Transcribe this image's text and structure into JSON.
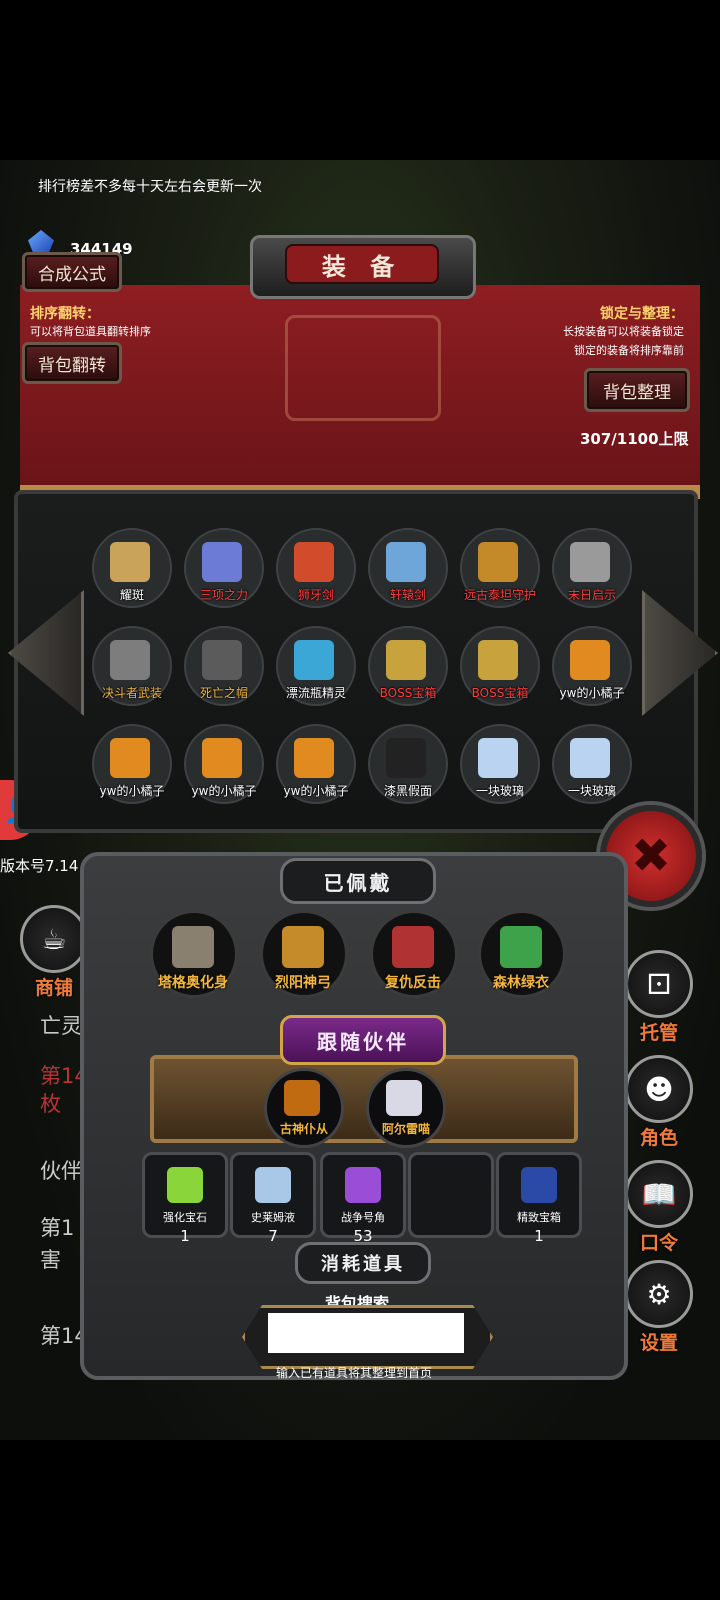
{
  "top_note": "排行榜差不多每十天左右会更新一次",
  "gem_count": "344149",
  "title": "装 备",
  "buttons": {
    "synthesis": "合成公式",
    "flip_bag": "背包翻转",
    "organize_bag": "背包整理"
  },
  "hints": {
    "sort_title": "排序翻转：",
    "sort_text": "可以将背包道具翻转排序",
    "lock_title": "锁定与整理：",
    "lock_text1": "长按装备可以将装备锁定",
    "lock_text2": "锁定的装备将排序靠前"
  },
  "capacity": "307/1100上限",
  "inventory": [
    {
      "label": "耀斑",
      "color": "#ffffff",
      "icon": "sword-icon"
    },
    {
      "label": "三项之力",
      "color": "#ff3b3b",
      "icon": "triple-weapon-icon"
    },
    {
      "label": "狮牙剑",
      "color": "#ff3b3b",
      "icon": "flame-sword-icon"
    },
    {
      "label": "轩辕剑",
      "color": "#ff3b3b",
      "icon": "sword-icon"
    },
    {
      "label": "远古泰坦守护",
      "color": "#ff3b3b",
      "icon": "titan-armor-icon"
    },
    {
      "label": "末日启示",
      "color": "#ff3b3b",
      "icon": "axe-icon"
    },
    {
      "label": "决斗者武装",
      "color": "#f4b63c",
      "icon": "knight-icon"
    },
    {
      "label": "死亡之帽",
      "color": "#f4b63c",
      "icon": "hat-icon"
    },
    {
      "label": "漂流瓶精灵",
      "color": "#ffffff",
      "icon": "spirit-icon"
    },
    {
      "label": "BOSS宝箱",
      "color": "#ff3b3b",
      "icon": "chest-icon"
    },
    {
      "label": "BOSS宝箱",
      "color": "#ff3b3b",
      "icon": "chest-icon"
    },
    {
      "label": "yw的小橘子",
      "color": "#ffffff",
      "icon": "orange-icon"
    },
    {
      "label": "yw的小橘子",
      "color": "#ffffff",
      "icon": "orange-icon"
    },
    {
      "label": "yw的小橘子",
      "color": "#ffffff",
      "icon": "orange-icon"
    },
    {
      "label": "yw的小橘子",
      "color": "#ffffff",
      "icon": "orange-icon"
    },
    {
      "label": "漆黑假面",
      "color": "#ffffff",
      "icon": "mask-icon"
    },
    {
      "label": "一块玻璃",
      "color": "#ffffff",
      "icon": "glass-icon"
    },
    {
      "label": "一块玻璃",
      "color": "#ffffff",
      "icon": "glass-icon"
    }
  ],
  "equipped_title": "已佩戴",
  "equipped": [
    {
      "label": "塔格奥化身",
      "icon": "avatar-icon"
    },
    {
      "label": "烈阳神弓",
      "icon": "bow-icon"
    },
    {
      "label": "复仇反击",
      "icon": "armor-icon"
    },
    {
      "label": "森林绿衣",
      "icon": "green-robe-icon"
    }
  ],
  "companions_title": "跟随伙伴",
  "companions": [
    {
      "label": "古神仆从",
      "icon": "servant-icon"
    },
    {
      "label": "阿尔雷喵",
      "icon": "cat-angel-icon"
    }
  ],
  "consumables": [
    {
      "label": "强化宝石",
      "qty": "1",
      "icon": "gem-icon"
    },
    {
      "label": "史莱姆液",
      "qty": "7",
      "icon": "potion-icon"
    },
    {
      "label": "战争号角",
      "qty": "53",
      "icon": "horn-icon"
    },
    {
      "label": "",
      "qty": "",
      "icon": ""
    },
    {
      "label": "精致宝箱",
      "qty": "1",
      "icon": "chest-icon"
    }
  ],
  "consumables_title": "消耗道具",
  "search": {
    "title": "背包搜索",
    "placeholder": "",
    "hint": "输入已有道具将其整理到首页"
  },
  "side_menu": {
    "shop": "商铺",
    "manage": "托管",
    "role": "角色",
    "command": "口令",
    "settings": "设置"
  },
  "background": {
    "version": "版本号7.14",
    "line1": "亡灵",
    "line2": "第14",
    "line3": "枚",
    "line4": "伙伴",
    "line5": "第1",
    "line6": "害",
    "line7": "第143351回:发现沈"
  },
  "colors": {
    "accent_red": "#8c1b1e",
    "gold_text": "#f4b63c",
    "hint_yellow": "#ffd36b"
  }
}
